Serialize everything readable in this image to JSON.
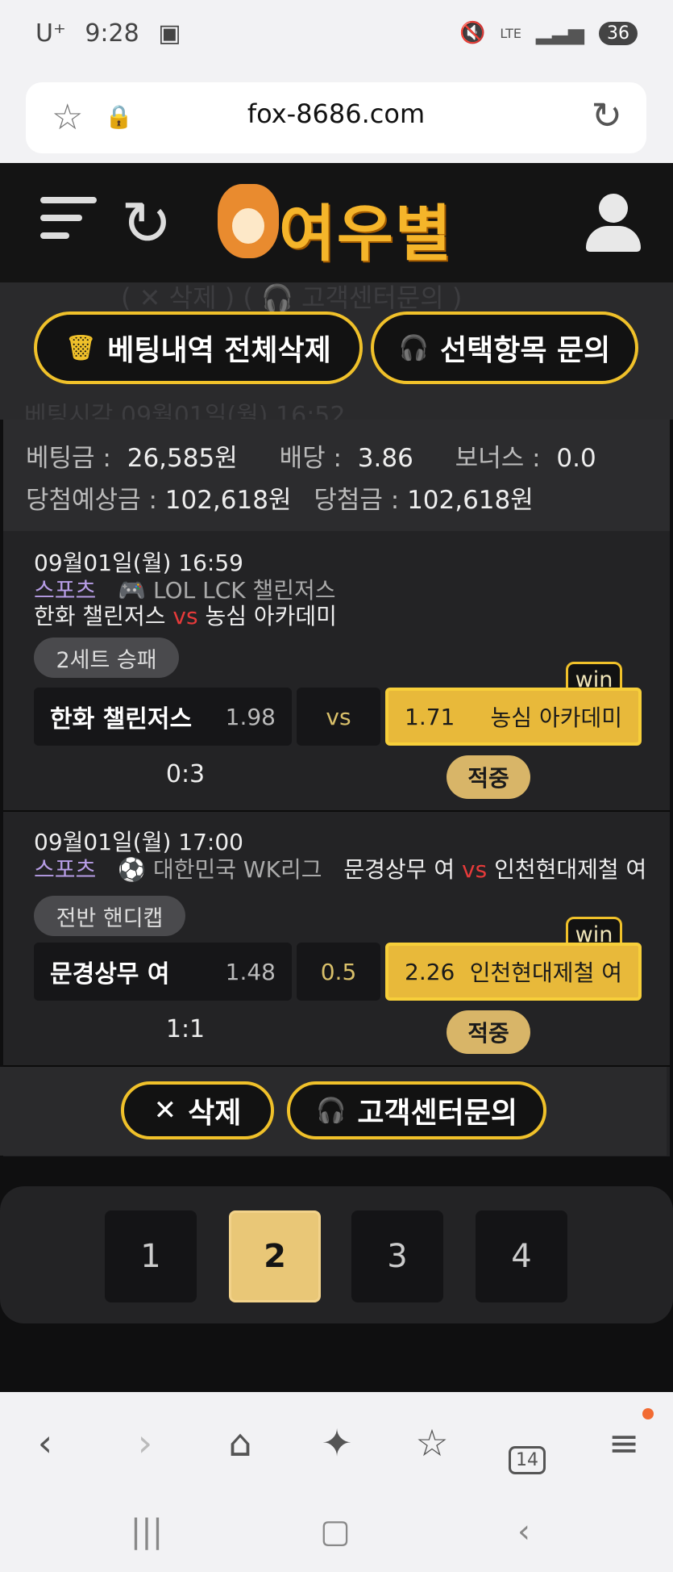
{
  "status": {
    "carrier": "U⁺",
    "time": "9:28",
    "network": "LTE",
    "battery": "36"
  },
  "browser": {
    "url": "fox-8686.com"
  },
  "site": {
    "logo_text": "여우별"
  },
  "ghost": {
    "top": "( ✕ 삭제 ) ( 🎧 고객센터문의 )",
    "bottom": "베팅시각 09월01일(월) 16:52"
  },
  "actions": {
    "delete_all": "베팅내역 전체삭제",
    "inquire_selected": "선택항목 문의",
    "delete": "삭제",
    "customer_center": "고객센터문의"
  },
  "summary": {
    "bet_label": "베팅금 :",
    "bet_value": "26,585원",
    "odds_label": "배당 :",
    "odds_value": "3.86",
    "bonus_label": "보너스 :",
    "bonus_value": "0.0",
    "expected_label": "당첨예상금 :",
    "expected_value": "102,618원",
    "won_label": "당첨금 :",
    "won_value": "102,618원"
  },
  "matches": [
    {
      "datetime": "09월01일(월) 16:59",
      "category": "스포츠",
      "league_icon": "gamepad-icon",
      "league": "LOL LCK 챌린저스",
      "home_team": "한화 챌린저스",
      "vs": "vs",
      "away_team": "농심 아카데미",
      "bet_type": "2세트 승패",
      "home_name": "한화 챌린저스",
      "home_odds": "1.98",
      "middle": "vs",
      "away_odds": "1.71",
      "away_name": "농심 아카데미",
      "win_tag": "win",
      "score": "0:3",
      "result": "적중"
    },
    {
      "datetime": "09월01일(월) 17:00",
      "category": "스포츠",
      "league_icon": "soccer-ball-icon",
      "league": "대한민국 WK리그",
      "home_team": "문경상무 여",
      "vs": "vs",
      "away_team": "인천현대제철 여",
      "bet_type": "전반 핸디캡",
      "home_name": "문경상무 여",
      "home_odds": "1.48",
      "middle": "0.5",
      "away_odds": "2.26",
      "away_name": "인천현대제철 여",
      "win_tag": "win",
      "score": "1:1",
      "result": "적중"
    }
  ],
  "pagination": {
    "pages": [
      "1",
      "2",
      "3",
      "4"
    ],
    "current": "2"
  },
  "nav": {
    "tabs_count": "14"
  },
  "colors": {
    "accent": "#f0c12a",
    "win_fill": "#e8b93a",
    "hit": "#d8b568",
    "page_active": "#e9c777",
    "vs_red": "#e63a3a"
  }
}
